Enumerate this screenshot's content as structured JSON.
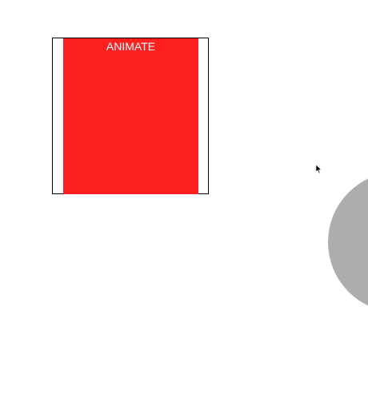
{
  "animate_button": {
    "label": "ANIMATE",
    "color": "#fe1f1f",
    "text_color": "#ffffff"
  },
  "circle": {
    "color": "#adadad"
  },
  "cursor": {
    "icon": "mouse-pointer-icon"
  }
}
